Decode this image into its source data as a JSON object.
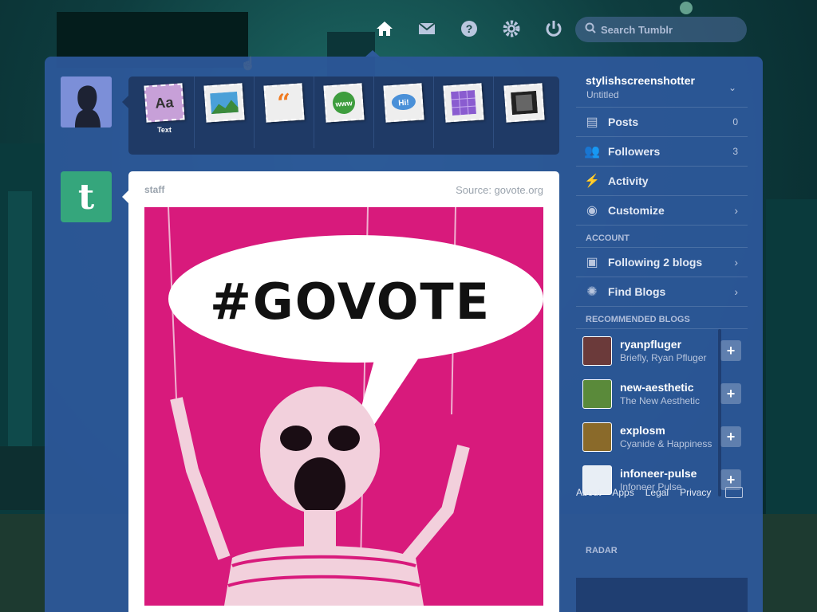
{
  "header": {
    "nav": [
      {
        "name": "home-icon"
      },
      {
        "name": "messages-icon"
      },
      {
        "name": "help-icon"
      },
      {
        "name": "settings-icon"
      },
      {
        "name": "logout-icon"
      }
    ],
    "search_placeholder": "Search Tumblr"
  },
  "post_types": [
    {
      "name": "text-post",
      "label": "Text"
    },
    {
      "name": "photo-post",
      "label": ""
    },
    {
      "name": "quote-post",
      "label": ""
    },
    {
      "name": "link-post",
      "label": ""
    },
    {
      "name": "chat-post",
      "label": ""
    },
    {
      "name": "audio-post",
      "label": ""
    },
    {
      "name": "video-post",
      "label": ""
    }
  ],
  "post": {
    "author": "staff",
    "source": "Source: govote.org",
    "image_text": "#GOVOTE"
  },
  "sidebar": {
    "blog_name": "stylishscreenshotter",
    "blog_title": "Untitled",
    "rows": [
      {
        "label": "Posts",
        "count": "0"
      },
      {
        "label": "Followers",
        "count": "3"
      },
      {
        "label": "Activity",
        "count": ""
      },
      {
        "label": "Customize",
        "count": ""
      }
    ],
    "account_heading": "ACCOUNT",
    "account_rows": [
      {
        "label": "Following 2 blogs"
      },
      {
        "label": "Find Blogs"
      }
    ],
    "recommended_heading": "RECOMMENDED BLOGS",
    "recommended": [
      {
        "name": "ryanpfluger",
        "sub": "Briefly, Ryan Pfluger"
      },
      {
        "name": "new-aesthetic",
        "sub": "The New Aesthetic"
      },
      {
        "name": "explosm",
        "sub": "Cyanide & Happiness"
      },
      {
        "name": "infoneer-pulse",
        "sub": "Infoneer Pulse"
      }
    ],
    "footer_links": [
      "About",
      "Apps",
      "Legal",
      "Privacy"
    ],
    "radar_heading": "RADAR"
  },
  "colors": {
    "dashboard": "#2d589b",
    "post_image_bg": "#d81a7c",
    "staff_avatar": "#35a67c"
  }
}
